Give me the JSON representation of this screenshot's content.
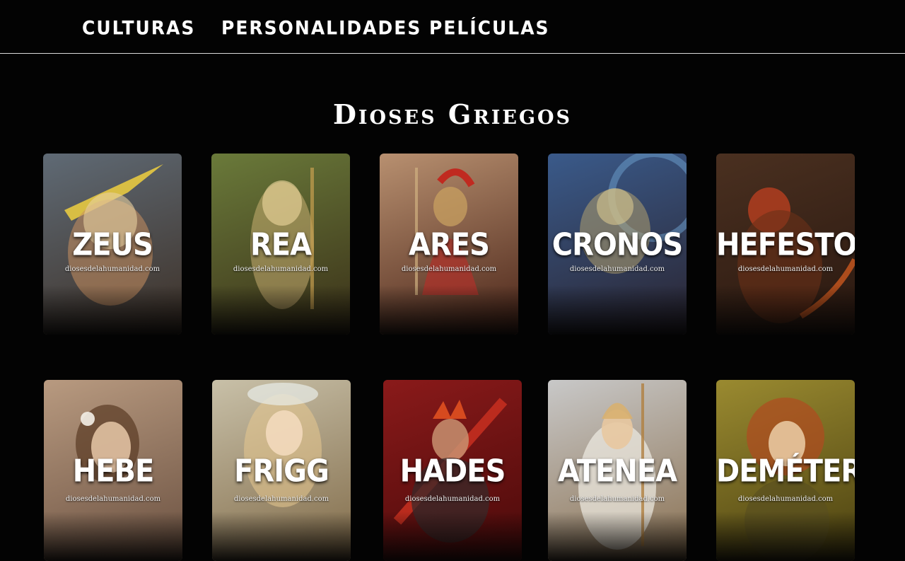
{
  "nav": {
    "items": [
      {
        "label": "Culturas"
      },
      {
        "label": "Personalidades"
      },
      {
        "label": "Películas"
      }
    ]
  },
  "page": {
    "title": "Dioses Griegos"
  },
  "site_watermark": "diosesdelahumanidad.com",
  "cards": [
    {
      "name": "Zeus",
      "colors": {
        "top": "#5f6a75",
        "bottom": "#3d3026",
        "figure": "#d0a070"
      }
    },
    {
      "name": "Rea",
      "colors": {
        "top": "#6a7a3a",
        "bottom": "#3a3018",
        "figure": "#e0c080"
      }
    },
    {
      "name": "Ares",
      "colors": {
        "top": "#b89070",
        "bottom": "#4a2418",
        "figure": "#b0302a"
      }
    },
    {
      "name": "Cronos",
      "colors": {
        "top": "#3a5a8a",
        "bottom": "#2a2430",
        "figure": "#b0a070"
      }
    },
    {
      "name": "Hefesto",
      "colors": {
        "top": "#4a3020",
        "bottom": "#2a1810",
        "figure": "#c04020"
      }
    },
    {
      "name": "Hebe",
      "colors": {
        "top": "#b89a80",
        "bottom": "#6a5040",
        "figure": "#8a5a3a"
      }
    },
    {
      "name": "Frigg",
      "colors": {
        "top": "#c8c0a8",
        "bottom": "#806a48",
        "figure": "#e8c890"
      }
    },
    {
      "name": "Hades",
      "colors": {
        "top": "#8a1a1a",
        "bottom": "#4a0a0a",
        "figure": "#3a2a2a"
      }
    },
    {
      "name": "Atenea",
      "colors": {
        "top": "#c8c8c8",
        "bottom": "#8a7050",
        "figure": "#d0b080"
      }
    },
    {
      "name": "Deméter",
      "colors": {
        "top": "#9a8a30",
        "bottom": "#4a4010",
        "figure": "#c05a2a"
      }
    }
  ]
}
